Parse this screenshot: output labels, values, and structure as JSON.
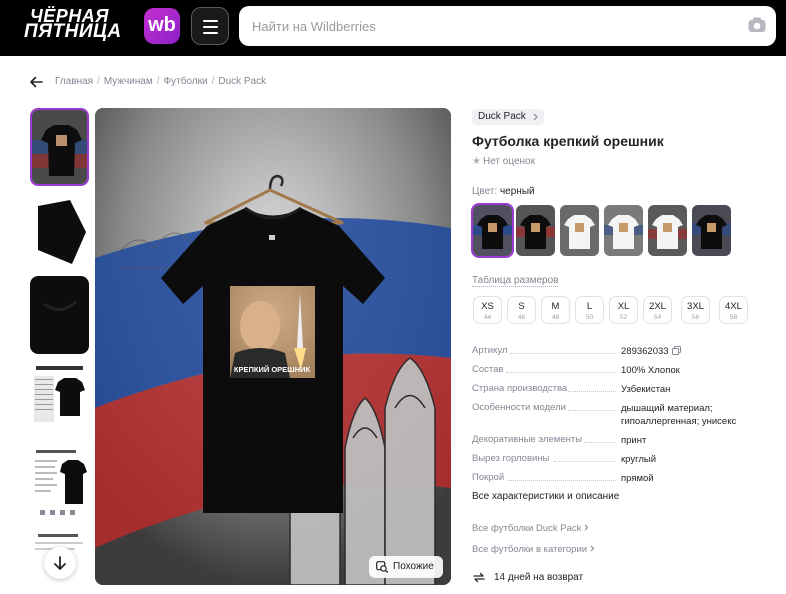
{
  "header": {
    "logo_line1": "ЧЁРНАЯ",
    "logo_line2": "ПЯТНИЦА",
    "wb_badge": "wb",
    "search_placeholder": "Найти на Wildberries",
    "camera_icon": "camera-icon",
    "menu_icon": "hamburger-icon"
  },
  "breadcrumb": [
    "Главная",
    "Мужчинам",
    "Футболки",
    "Duck Pack"
  ],
  "gallery": {
    "thumbnails": [
      "tshirt-front",
      "tshirt-sleeve",
      "tshirt-collar",
      "size-table",
      "specs-card",
      "care-card"
    ],
    "similar_label": "Похожие"
  },
  "product": {
    "brand": "Duck Pack",
    "title": "Футболка крепкий орешник",
    "rating_text": "Нет оценок",
    "print_caption": "КРЕПКИЙ ОРЕШНИК",
    "color_label": "Цвет:",
    "color_value": "черный",
    "sizes_link": "Таблица размеров",
    "sizes": [
      {
        "label": "XS",
        "ru": "44"
      },
      {
        "label": "S",
        "ru": "46"
      },
      {
        "label": "M",
        "ru": "48"
      },
      {
        "label": "L",
        "ru": "50"
      },
      {
        "label": "XL",
        "ru": "52"
      },
      {
        "label": "2XL",
        "ru": "54"
      },
      {
        "label": "3XL",
        "ru": "56"
      },
      {
        "label": "4XL",
        "ru": "58"
      }
    ],
    "specs": [
      {
        "key": "Артикул",
        "value": "289362033"
      },
      {
        "key": "Состав",
        "value": "100% Хлопок"
      },
      {
        "key": "Страна производства",
        "value": "Узбекистан"
      },
      {
        "key": "Особенности модели",
        "value": "дышащий материал; гипоаллергенная; унисекс"
      },
      {
        "key": "Декоративные элементы",
        "value": "принт"
      },
      {
        "key": "Вырез горловины",
        "value": "круглый"
      },
      {
        "key": "Покрой",
        "value": "прямой"
      }
    ],
    "all_specs": "Все характеристики и описание",
    "links": [
      "Все футболки Duck Pack",
      "Все футболки в категории"
    ],
    "returns": "14 дней на возврат"
  },
  "colors": {
    "accent": "#9b3ad0",
    "header_bg": "#000000"
  }
}
